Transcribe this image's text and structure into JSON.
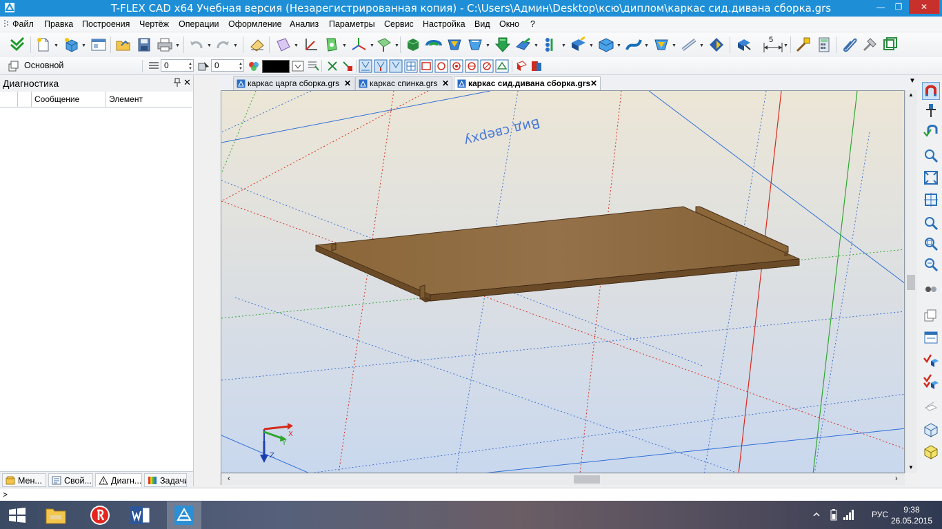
{
  "window": {
    "title": "T-FLEX CAD x64 Учебная версия (Незарегистрированная копия) - C:\\Users\\Админ\\Desktop\\ксю\\диплом\\каркас сид.дивана сборка.grs",
    "minimize_label": "—",
    "maximize_label": "❐",
    "close_label": "✕"
  },
  "menu": [
    "Файл",
    "Правка",
    "Построения",
    "Чертёж",
    "Операции",
    "Оформление",
    "Анализ",
    "Параметры",
    "Сервис",
    "Настройка",
    "Вид",
    "Окно",
    "?"
  ],
  "toolbar2": {
    "layer_name": "Основной",
    "width_value": "0",
    "priority_value": "0",
    "dimension_value": "5"
  },
  "left_panel": {
    "title": "Диагностика",
    "pin_icon": "pin-icon",
    "close_label": "✕",
    "columns": [
      "",
      "Сообщение",
      "Элемент"
    ],
    "tabs": [
      {
        "label": "Мен...",
        "icon": "menu-tree-icon"
      },
      {
        "label": "Свой...",
        "icon": "properties-icon"
      },
      {
        "label": "Диагн...",
        "icon": "warning-icon"
      },
      {
        "label": "Задачи",
        "icon": "tasks-icon"
      }
    ]
  },
  "doc_tabs": [
    {
      "label": "каркас царга сборка.grs",
      "close": "✕",
      "active": false
    },
    {
      "label": "каркас спинка.grs",
      "close": "✕",
      "active": false
    },
    {
      "label": "каркас сид.дивана сборка.grs",
      "close": "✕",
      "active": true
    }
  ],
  "viewport": {
    "plane_label": "Вид сверху",
    "axes": {
      "x": "X",
      "y": "Y",
      "z": "Z"
    },
    "colors": {
      "board_top": "#8f6b3f",
      "board_edge": "#6b4b27",
      "grid_blue": "#2f6fd8",
      "axis_red": "#d42a1c",
      "axis_green": "#2fa62f",
      "bg_top": "#ece6d6",
      "bg_bottom": "#c9d8ee"
    }
  },
  "command_line": {
    "prompt": ">"
  },
  "taskbar": {
    "apps": [
      "windows-start",
      "file-explorer",
      "yandex-browser",
      "microsoft-word",
      "t-flex-cad"
    ],
    "language": "РУС",
    "time": "9:38",
    "date": "26.05.2015"
  }
}
